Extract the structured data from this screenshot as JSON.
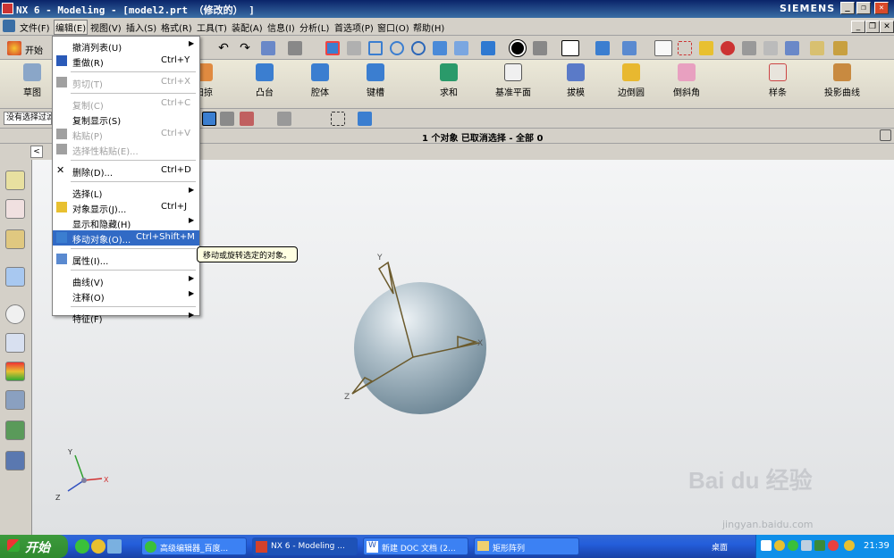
{
  "window": {
    "title": "NX 6 - Modeling - [model2.prt （修改的） ]",
    "brand": "SIEMENS",
    "controls": [
      "_",
      "❐",
      "✕"
    ]
  },
  "menubar": [
    "文件(F)",
    "编辑(E)",
    "视图(V)",
    "插入(S)",
    "格式(R)",
    "工具(T)",
    "装配(A)",
    "信息(I)",
    "分析(L)",
    "首选项(P)",
    "窗口(O)",
    "帮助(H)"
  ],
  "toolbar1": {
    "start_label": "开始"
  },
  "toolbar2": {
    "left_label": "草图",
    "buttons": [
      "扫掠",
      "凸台",
      "腔体",
      "键槽",
      "求和",
      "基准平面",
      "拔模",
      "边倒圆",
      "倒斜角",
      "样条",
      "投影曲线"
    ]
  },
  "toolbar3": {
    "filter_value": "没有选择过滤"
  },
  "status": {
    "message": "1 个对象 已取消选择 - 全部 0"
  },
  "edit_menu": {
    "items": [
      {
        "label": "撤消列表(U)",
        "shortcut": "",
        "arrow": "▶",
        "disabled": false,
        "icon": ""
      },
      {
        "label": "重做(R)",
        "shortcut": "Ctrl+Y",
        "arrow": "",
        "disabled": false,
        "icon": "redo-icon"
      },
      {
        "label": "剪切(T)",
        "shortcut": "Ctrl+X",
        "arrow": "",
        "disabled": true,
        "icon": "cut-icon"
      },
      {
        "label": "复制(C)",
        "shortcut": "Ctrl+C",
        "arrow": "",
        "disabled": true,
        "icon": ""
      },
      {
        "label": "复制显示(S)",
        "shortcut": "",
        "arrow": "",
        "disabled": false,
        "icon": ""
      },
      {
        "label": "粘贴(P)",
        "shortcut": "Ctrl+V",
        "arrow": "",
        "disabled": true,
        "icon": "paste-icon"
      },
      {
        "label": "选择性粘贴(E)...",
        "shortcut": "",
        "arrow": "",
        "disabled": true,
        "icon": "paste-special-icon"
      },
      {
        "label": "删除(D)...",
        "shortcut": "Ctrl+D",
        "arrow": "",
        "disabled": false,
        "icon": "delete-icon"
      },
      {
        "label": "选择(L)",
        "shortcut": "",
        "arrow": "▶",
        "disabled": false,
        "icon": ""
      },
      {
        "label": "对象显示(J)...",
        "shortcut": "Ctrl+J",
        "arrow": "",
        "disabled": false,
        "icon": "object-display-icon"
      },
      {
        "label": "显示和隐藏(H)",
        "shortcut": "",
        "arrow": "▶",
        "disabled": false,
        "icon": ""
      },
      {
        "label": "移动对象(O)...",
        "shortcut": "Ctrl+Shift+M",
        "arrow": "",
        "disabled": false,
        "icon": "move-object-icon"
      },
      {
        "label": "属性(I)...",
        "shortcut": "",
        "arrow": "",
        "disabled": false,
        "icon": "properties-icon"
      },
      {
        "label": "曲线(V)",
        "shortcut": "",
        "arrow": "▶",
        "disabled": false,
        "icon": ""
      },
      {
        "label": "注释(O)",
        "shortcut": "",
        "arrow": "▶",
        "disabled": false,
        "icon": ""
      },
      {
        "label": "特征(F)",
        "shortcut": "",
        "arrow": "▶",
        "disabled": false,
        "icon": ""
      }
    ],
    "highlighted_label": "移动对象(O)..."
  },
  "tooltip": "移动或旋转选定的对象。",
  "axes": {
    "csys_y": "Y",
    "csys_x": "X",
    "csys_z": "Z",
    "wcs_y": "Y",
    "wcs_x": "X",
    "wcs_z": "Z"
  },
  "watermark": {
    "main": "Bai du 经验",
    "url": "jingyan.baidu.com"
  },
  "taskbar": {
    "start": "开始",
    "tasks": [
      "高级编辑器_百度...",
      "NX 6 - Modeling ...",
      "新建 DOC 文档 (2...",
      "矩形阵列"
    ],
    "desktop": "桌面",
    "clock": "21:39"
  },
  "colors": {
    "sphere": "#aebfc9",
    "highlight": "#316ac5",
    "title_bg": "#0a246a"
  }
}
